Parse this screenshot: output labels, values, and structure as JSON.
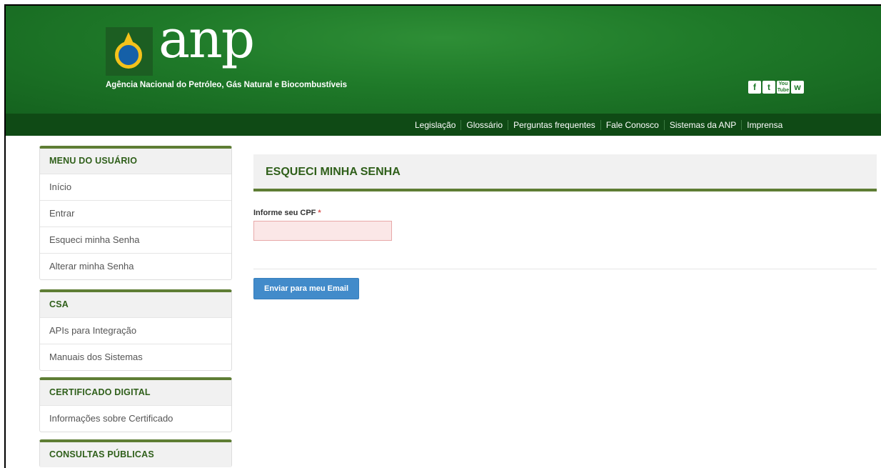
{
  "header": {
    "logo_text": "anp",
    "agency_name": "Agência Nacional do Petróleo, Gás Natural e Biocombustíveis",
    "social": [
      {
        "icon": "facebook-icon",
        "glyph": "f"
      },
      {
        "icon": "twitter-icon",
        "glyph": "t"
      },
      {
        "icon": "youtube-icon",
        "glyph": "You Tube"
      },
      {
        "icon": "flickr-icon",
        "glyph": "w"
      }
    ],
    "nav": [
      "Legislação",
      "Glossário",
      "Perguntas frequentes",
      "Fale Conosco",
      "Sistemas da ANP",
      "Imprensa"
    ]
  },
  "sidebar": {
    "menu_usuario": {
      "title": "MENU DO USUÁRIO",
      "items": [
        "Início",
        "Entrar",
        "Esqueci minha Senha",
        "Alterar minha Senha"
      ]
    },
    "csa": {
      "title": "CSA",
      "items": [
        "APIs para Integração",
        "Manuais dos Sistemas"
      ]
    },
    "certificado": {
      "title": "CERTIFICADO DIGITAL",
      "items": [
        "Informações sobre Certificado"
      ]
    },
    "consultas": {
      "title": "CONSULTAS PÚBLICAS"
    }
  },
  "main": {
    "title": "ESQUECI MINHA SENHA",
    "cpf_label": "Informe seu CPF",
    "required_mark": "*",
    "cpf_value": "",
    "submit_label": "Enviar para meu Email"
  },
  "colors": {
    "header_green": "#1f7a29",
    "nav_dark_green": "#0f4a15",
    "accent_olive": "#5e7d34",
    "button_blue": "#428bca"
  }
}
